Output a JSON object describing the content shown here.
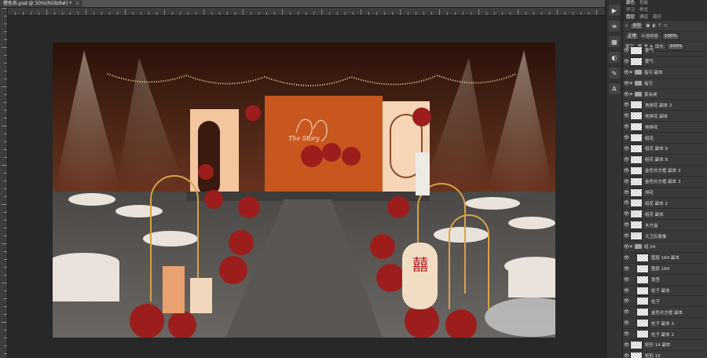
{
  "document": {
    "tab_title": "橙色系.psd @ 50%(RGB/8#) *",
    "close_glyph": "×"
  },
  "panel": {
    "tabs": [
      "颜色",
      "色板"
    ],
    "tabs2": [
      "学习",
      "样式"
    ],
    "tabs3": [
      "图层",
      "通道",
      "路径"
    ],
    "filter_kind": "类型",
    "blend_mode": "正常",
    "opacity_label": "不透明度:",
    "opacity_value": "100%",
    "lock_label": "锁定:",
    "fill_label": "填充:",
    "fill_value": "100%"
  },
  "layers": [
    {
      "name": "雾气",
      "type": "layer",
      "indent": false
    },
    {
      "name": "雾气",
      "type": "layer",
      "indent": false
    },
    {
      "name": "指引 副本",
      "type": "group",
      "indent": false
    },
    {
      "name": "指引",
      "type": "group",
      "indent": false
    },
    {
      "name": "宴会桌",
      "type": "group",
      "indent": false
    },
    {
      "name": "地排花 副本 2",
      "type": "layer",
      "indent": false
    },
    {
      "name": "地排花 副本",
      "type": "layer",
      "indent": false
    },
    {
      "name": "地排花",
      "type": "layer",
      "indent": false
    },
    {
      "name": "组花",
      "type": "layer",
      "indent": false
    },
    {
      "name": "组花 副本 9",
      "type": "layer",
      "indent": false
    },
    {
      "name": "组花 副本 8",
      "type": "layer",
      "indent": false
    },
    {
      "name": "金色长方框 副本 3",
      "type": "layer",
      "indent": false
    },
    {
      "name": "金色长方框 副本 3",
      "type": "layer",
      "indent": false
    },
    {
      "name": "排花",
      "type": "layer",
      "indent": false
    },
    {
      "name": "组花 副本 2",
      "type": "layer",
      "indent": false
    },
    {
      "name": "组花 副本",
      "type": "layer",
      "indent": false
    },
    {
      "name": "木方盒",
      "type": "layer",
      "indent": false
    },
    {
      "name": "大卫石膏像",
      "type": "layer",
      "indent": false
    },
    {
      "name": "组 24",
      "type": "group",
      "indent": false
    },
    {
      "name": "图层 164 副本",
      "type": "layer",
      "indent": true
    },
    {
      "name": "图层 164",
      "type": "layer",
      "indent": true
    },
    {
      "name": "喜签",
      "type": "layer",
      "indent": true
    },
    {
      "name": "柱子 副本",
      "type": "layer",
      "indent": true
    },
    {
      "name": "柱子",
      "type": "layer",
      "indent": true
    },
    {
      "name": "金色长方框 副本",
      "type": "layer",
      "indent": true
    },
    {
      "name": "柱子 副本 3",
      "type": "layer",
      "indent": true
    },
    {
      "name": "柱子 副本 2",
      "type": "layer",
      "indent": true
    },
    {
      "name": "矩形 14 副本",
      "type": "layer",
      "indent": false
    },
    {
      "name": "矩形 15",
      "type": "layer",
      "indent": false
    }
  ],
  "artwork": {
    "sign_text": "囍",
    "backdrop_script": "The Story"
  },
  "colors": {
    "backdrop": "#c8571f",
    "panel_peach": "#f3c6a0",
    "wall": "#4a2416",
    "floor": "#5d5a57",
    "flower_red": "#9c1e1c",
    "gold": "#d8a24a"
  }
}
